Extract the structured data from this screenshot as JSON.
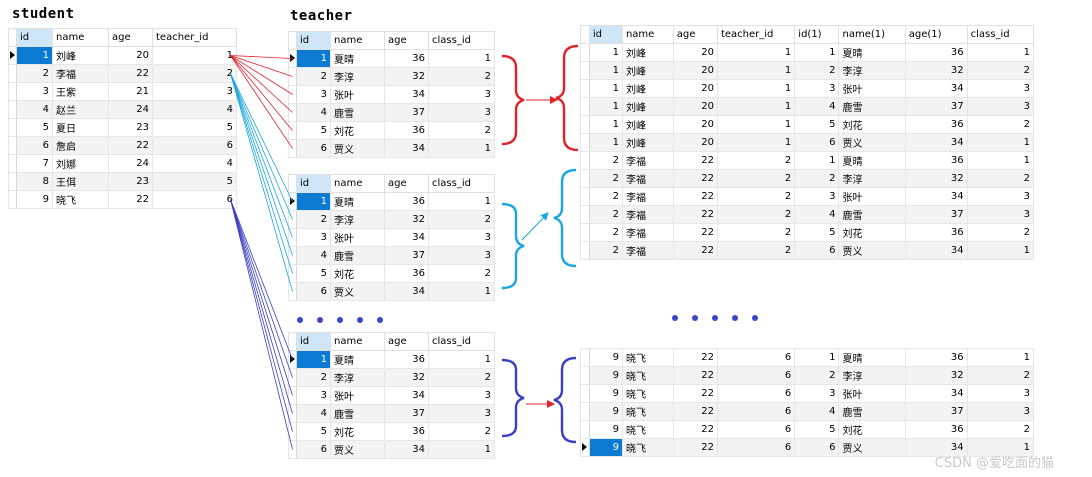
{
  "titles": {
    "student": "student",
    "teacher": "teacher"
  },
  "watermark": "CSDN @爱吃面的猫",
  "colors": {
    "red": "#e0242b",
    "cyan": "#1aa6e0",
    "blue": "#3b3fc4",
    "selection": "#0a7ad3"
  },
  "student": {
    "columns": [
      "id",
      "name",
      "age",
      "teacher_id"
    ],
    "rows": [
      [
        "1",
        "刘峰",
        "20",
        "1"
      ],
      [
        "2",
        "李福",
        "22",
        "2"
      ],
      [
        "3",
        "王紫",
        "21",
        "3"
      ],
      [
        "4",
        "赵兰",
        "24",
        "4"
      ],
      [
        "5",
        "夏日",
        "23",
        "5"
      ],
      [
        "6",
        "詹启",
        "22",
        "6"
      ],
      [
        "7",
        "刘娜",
        "24",
        "4"
      ],
      [
        "8",
        "王佴",
        "23",
        "5"
      ],
      [
        "9",
        "晓飞",
        "22",
        "6"
      ]
    ]
  },
  "teacher": {
    "columns": [
      "id",
      "name",
      "age",
      "class_id"
    ],
    "rows": [
      [
        "1",
        "夏晴",
        "36",
        "1"
      ],
      [
        "2",
        "李淳",
        "32",
        "2"
      ],
      [
        "3",
        "张叶",
        "34",
        "3"
      ],
      [
        "4",
        "鹿雪",
        "37",
        "3"
      ],
      [
        "5",
        "刘花",
        "36",
        "2"
      ],
      [
        "6",
        "贾义",
        "34",
        "1"
      ]
    ]
  },
  "result": {
    "columns": [
      "id",
      "name",
      "age",
      "teacher_id",
      "id(1)",
      "name(1)",
      "age(1)",
      "class_id"
    ],
    "top_rows": [
      [
        "1",
        "刘峰",
        "20",
        "1",
        "1",
        "夏晴",
        "36",
        "1"
      ],
      [
        "1",
        "刘峰",
        "20",
        "1",
        "2",
        "李淳",
        "32",
        "2"
      ],
      [
        "1",
        "刘峰",
        "20",
        "1",
        "3",
        "张叶",
        "34",
        "3"
      ],
      [
        "1",
        "刘峰",
        "20",
        "1",
        "4",
        "鹿雪",
        "37",
        "3"
      ],
      [
        "1",
        "刘峰",
        "20",
        "1",
        "5",
        "刘花",
        "36",
        "2"
      ],
      [
        "1",
        "刘峰",
        "20",
        "1",
        "6",
        "贾义",
        "34",
        "1"
      ],
      [
        "2",
        "李福",
        "22",
        "2",
        "1",
        "夏晴",
        "36",
        "1"
      ],
      [
        "2",
        "李福",
        "22",
        "2",
        "2",
        "李淳",
        "32",
        "2"
      ],
      [
        "2",
        "李福",
        "22",
        "2",
        "3",
        "张叶",
        "34",
        "3"
      ],
      [
        "2",
        "李福",
        "22",
        "2",
        "4",
        "鹿雪",
        "37",
        "3"
      ],
      [
        "2",
        "李福",
        "22",
        "2",
        "5",
        "刘花",
        "36",
        "2"
      ],
      [
        "2",
        "李福",
        "22",
        "2",
        "6",
        "贾义",
        "34",
        "1"
      ]
    ],
    "bottom_rows": [
      [
        "9",
        "晓飞",
        "22",
        "6",
        "1",
        "夏晴",
        "36",
        "1"
      ],
      [
        "9",
        "晓飞",
        "22",
        "6",
        "2",
        "李淳",
        "32",
        "2"
      ],
      [
        "9",
        "晓飞",
        "22",
        "6",
        "3",
        "张叶",
        "34",
        "3"
      ],
      [
        "9",
        "晓飞",
        "22",
        "6",
        "4",
        "鹿雪",
        "37",
        "3"
      ],
      [
        "9",
        "晓飞",
        "22",
        "6",
        "5",
        "刘花",
        "36",
        "2"
      ],
      [
        "9",
        "晓飞",
        "22",
        "6",
        "6",
        "贾义",
        "34",
        "1"
      ]
    ]
  }
}
